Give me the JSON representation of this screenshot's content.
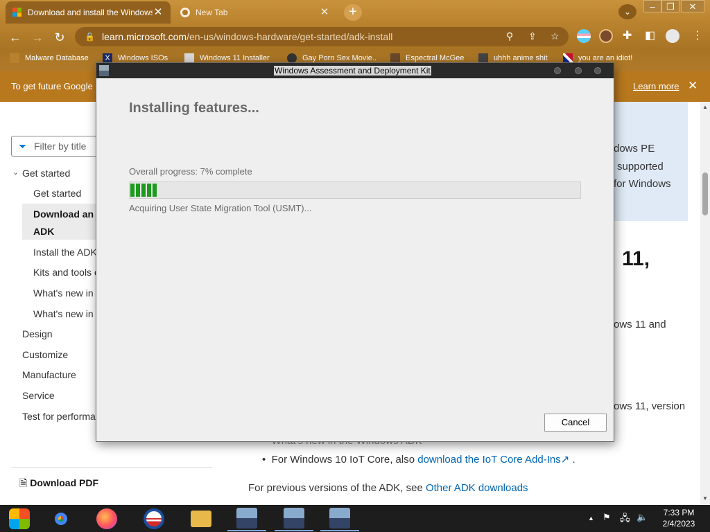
{
  "browser": {
    "tabs": [
      {
        "title": "Download and install the Windows",
        "icon": "microsoft-logo-icon"
      },
      {
        "title": "New Tab",
        "icon": "chrome-icon"
      }
    ],
    "url_host": "learn.microsoft.com",
    "url_path": "/en-us/windows-hardware/get-started/adk-install",
    "bookmarks": [
      "Malware Database",
      "Windows ISOs",
      "Windows 11 Installer",
      "Gay Porn Sex Movie..",
      "Espectral McGee",
      "uhhh anime shit",
      "you are an idiot!"
    ]
  },
  "infobar": {
    "message": "To get future Google",
    "learn_more": "Learn more"
  },
  "page": {
    "filter_placeholder": "Filter by title",
    "toc": {
      "get_started_group": "Get started",
      "get_started": "Get started",
      "download_line1": "Download an",
      "download_line2": "ADK",
      "install_adk": "Install the ADK",
      "kits_tools": "Kits and tools o",
      "whats_new_1": "What's new in",
      "whats_new_2": "What's new in",
      "design": "Design",
      "customize": "Customize",
      "manufacture": "Manufacture",
      "service": "Service",
      "test": "Test for performa"
    },
    "download_pdf": "Download PDF",
    "alert_lines": [
      "dows PE",
      "supported",
      "for Windows"
    ],
    "heading_frag": "11,",
    "para1": "ows 11 and",
    "para2": "ows 11, version",
    "bullet_hidden": "What's new in the Windows ADK",
    "bullet_text": "For Windows 10 IoT Core, also ",
    "bullet_link": "download the IoT Core Add-Ins",
    "bullet_end": " .",
    "prev_text": "For previous versions of the ADK, see ",
    "prev_link": "Other ADK downloads"
  },
  "dialog": {
    "title": "Windows Assessment and Deployment Kit",
    "heading": "Installing features...",
    "progress_label": "Overall progress: 7% complete",
    "progress_percent": 7,
    "status": "Acquiring User State Migration Tool (USMT)...",
    "cancel_label": "Cancel"
  },
  "taskbar": {
    "apps": [
      "windows-start-icon",
      "chrome-icon",
      "firefox-icon",
      "obama-icon",
      "file-explorer-icon",
      "installer-icon",
      "installer-icon",
      "installer-icon"
    ],
    "time": "7:33 PM",
    "date": "2/4/2023"
  },
  "colors": {
    "chrome_bg": "#b8812d",
    "infobar_bg": "#b8781e",
    "progress_fill": "#1e9a1e",
    "link": "#0065b3"
  }
}
